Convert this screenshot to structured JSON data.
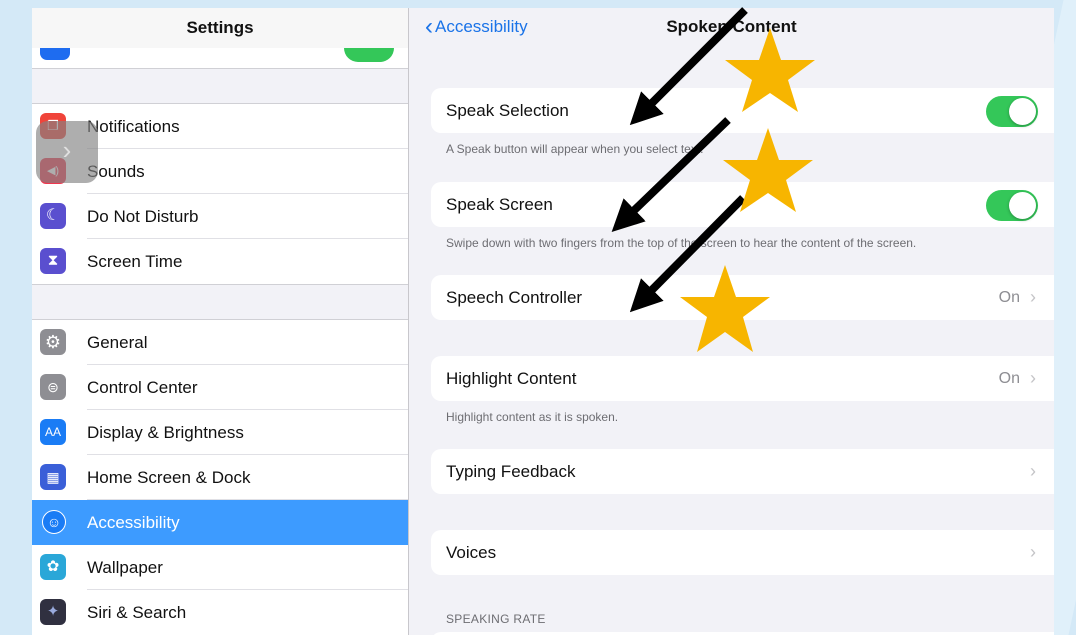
{
  "sidebar": {
    "title": "Settings",
    "items": [
      {
        "label": "Notifications",
        "icon": "notifications-icon",
        "color": "#f0443a",
        "glyph": "❐"
      },
      {
        "label": "Sounds",
        "icon": "sounds-icon",
        "color": "#f0374f",
        "glyph": "🔊"
      },
      {
        "label": "Do Not Disturb",
        "icon": "moon-icon",
        "color": "#5a4fcf",
        "glyph": "☾"
      },
      {
        "label": "Screen Time",
        "icon": "hourglass-icon",
        "color": "#5a4fcf",
        "glyph": "⌛"
      },
      {
        "label": "General",
        "icon": "gear-icon",
        "color": "#8e8e93",
        "glyph": "⚙"
      },
      {
        "label": "Control Center",
        "icon": "control-center-icon",
        "color": "#8e8e93",
        "glyph": "◉"
      },
      {
        "label": "Display & Brightness",
        "icon": "display-icon",
        "color": "#1a7cf5",
        "glyph": "AA"
      },
      {
        "label": "Home Screen & Dock",
        "icon": "home-screen-icon",
        "color": "#3a5fd8",
        "glyph": "▦"
      },
      {
        "label": "Accessibility",
        "icon": "accessibility-icon",
        "color": "#1a7cf5",
        "glyph": "♿"
      },
      {
        "label": "Wallpaper",
        "icon": "wallpaper-icon",
        "color": "#2aa7d8",
        "glyph": "✿"
      },
      {
        "label": "Siri & Search",
        "icon": "siri-icon",
        "color": "#303040",
        "glyph": "✦"
      }
    ]
  },
  "nav": {
    "back_label": "Accessibility",
    "title": "Spoken Content"
  },
  "rows": {
    "speak_selection": {
      "label": "Speak Selection",
      "toggle": "on"
    },
    "speak_selection_footer": "A Speak button will appear when you select text.",
    "speak_screen": {
      "label": "Speak Screen",
      "toggle": "on"
    },
    "speak_screen_footer": "Swipe down with two fingers from the top of the screen to hear the content of the screen.",
    "speech_controller": {
      "label": "Speech Controller",
      "value": "On"
    },
    "highlight_content": {
      "label": "Highlight Content",
      "value": "On"
    },
    "highlight_content_footer": "Highlight content as it is spoken.",
    "typing_feedback": {
      "label": "Typing Feedback"
    },
    "voices": {
      "label": "Voices"
    },
    "speaking_rate_header": "SPEAKING RATE"
  },
  "colors": {
    "accent": "#3d9bff",
    "toggle_on": "#34c759",
    "star": "#f7b500",
    "arrow": "#000000"
  }
}
